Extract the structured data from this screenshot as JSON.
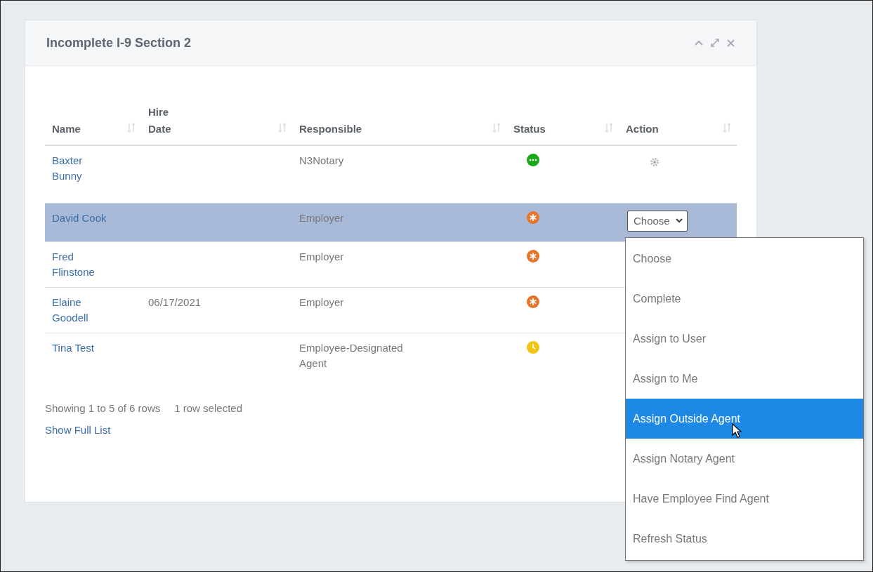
{
  "panel": {
    "title": "Incomplete I-9 Section 2"
  },
  "table": {
    "columns": [
      "Name",
      "Hire Date",
      "Responsible",
      "Status",
      "Action"
    ],
    "rows": [
      {
        "name": "Baxter Bunny",
        "responsible": "N3Notary",
        "status": {
          "kind": "dots"
        },
        "action": {
          "kind": "gear"
        },
        "selected": false
      },
      {
        "name": "David Cook",
        "responsible": "Employer",
        "status": {
          "kind": "asterisk"
        },
        "action": {
          "kind": "select",
          "value": "Choose"
        },
        "selected": true
      },
      {
        "name": "Fred Flinstone",
        "responsible": "Employer",
        "status": {
          "kind": "asterisk"
        },
        "selected": false
      },
      {
        "name": "Elaine Goodell",
        "hire_date": "06/17/2021",
        "responsible": "Employer",
        "status": {
          "kind": "asterisk"
        },
        "selected": false
      },
      {
        "name": "Tina Test",
        "responsible": "Employee-Designated Agent",
        "status": {
          "kind": "clock"
        },
        "selected": false
      }
    ]
  },
  "footer": {
    "info": "Showing 1 to 5 of 6 rows",
    "selection": "1 row selected",
    "link": "Show Full List"
  },
  "dropdown": {
    "options": [
      {
        "label": "Choose",
        "selected": false
      },
      {
        "label": "Complete",
        "selected": false
      },
      {
        "label": "Assign to User",
        "selected": false
      },
      {
        "label": "Assign to Me",
        "selected": false
      },
      {
        "label": "Assign Outside Agent",
        "selected": true
      },
      {
        "label": "Assign Notary Agent",
        "selected": false
      },
      {
        "label": "Have Employee Find Agent",
        "selected": false
      },
      {
        "label": "Refresh Status",
        "selected": false
      }
    ]
  }
}
